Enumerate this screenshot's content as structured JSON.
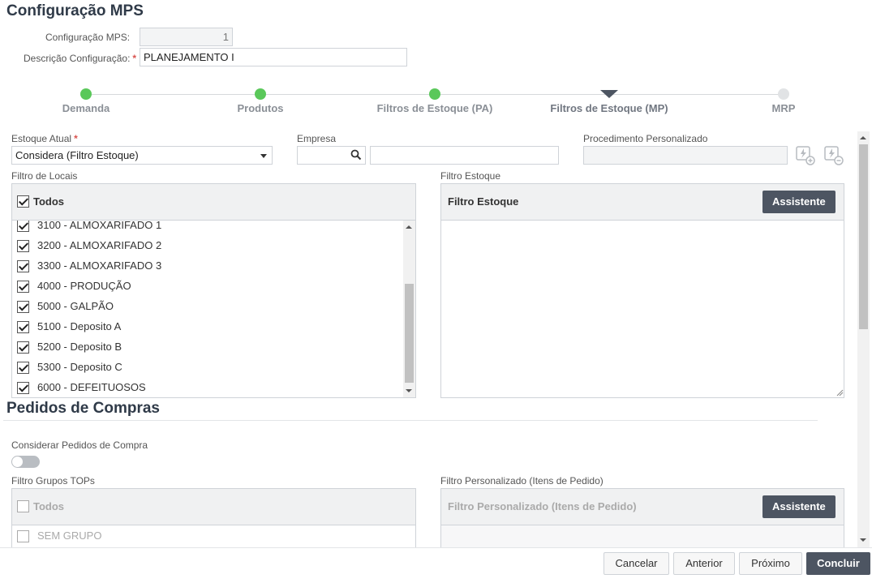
{
  "page": {
    "title": "Configuração MPS"
  },
  "form": {
    "config_label": "Configuração MPS:",
    "config_value": "1",
    "desc_label": "Descrição Configuração:",
    "desc_value": "PLANEJAMENTO I",
    "required_mark": "*"
  },
  "wizard": {
    "steps": [
      {
        "label": "Demanda",
        "state": "done"
      },
      {
        "label": "Produtos",
        "state": "done"
      },
      {
        "label": "Filtros de Estoque (PA)",
        "state": "done"
      },
      {
        "label": "Filtros de Estoque (MP)",
        "state": "current"
      },
      {
        "label": "MRP",
        "state": "pending"
      }
    ]
  },
  "estoque": {
    "estoque_atual_label": "Estoque Atual",
    "estoque_atual_value": "Considera (Filtro Estoque)",
    "empresa_label": "Empresa",
    "empresa_code": "",
    "empresa_name": "",
    "procedimento_label": "Procedimento Personalizado",
    "procedimento_value": "",
    "icons": [
      "add-procedure-icon",
      "remove-procedure-icon"
    ]
  },
  "locais": {
    "label": "Filtro de Locais",
    "all_label": "Todos",
    "all_checked": true,
    "items": [
      {
        "label": "3100 - ALMOXARIFADO 1",
        "checked": true
      },
      {
        "label": "3200 - ALMOXARIFADO 2",
        "checked": true
      },
      {
        "label": "3300 - ALMOXARIFADO 3",
        "checked": true
      },
      {
        "label": "4000 - PRODUÇÃO",
        "checked": true
      },
      {
        "label": "5000 - GALPÃO",
        "checked": true
      },
      {
        "label": "5100 - Deposito A",
        "checked": true
      },
      {
        "label": "5200 - Deposito B",
        "checked": true
      },
      {
        "label": "5300 - Deposito C",
        "checked": true
      },
      {
        "label": "6000 - DEFEITUOSOS",
        "checked": true
      }
    ]
  },
  "filtro_estoque": {
    "label": "Filtro Estoque",
    "header": "Filtro Estoque",
    "button": "Assistente",
    "value": ""
  },
  "pedidos": {
    "title": "Pedidos de Compras",
    "toggle_label": "Considerar Pedidos de Compra",
    "toggle_on": false,
    "grupos_label": "Filtro Grupos TOPs",
    "grupos_all": "Todos",
    "grupos_items": [
      {
        "label": "SEM GRUPO",
        "checked": false
      }
    ],
    "personalizado_label": "Filtro Personalizado (Itens de Pedido)",
    "personalizado_header": "Filtro Personalizado (Itens de Pedido)",
    "personalizado_button": "Assistente"
  },
  "footer": {
    "cancel": "Cancelar",
    "previous": "Anterior",
    "next": "Próximo",
    "finish": "Concluir"
  },
  "colors": {
    "step_done": "#5ac85a",
    "step_pending": "#e1e3e5",
    "primary_button": "#4d5562",
    "required": "#d9534f"
  }
}
